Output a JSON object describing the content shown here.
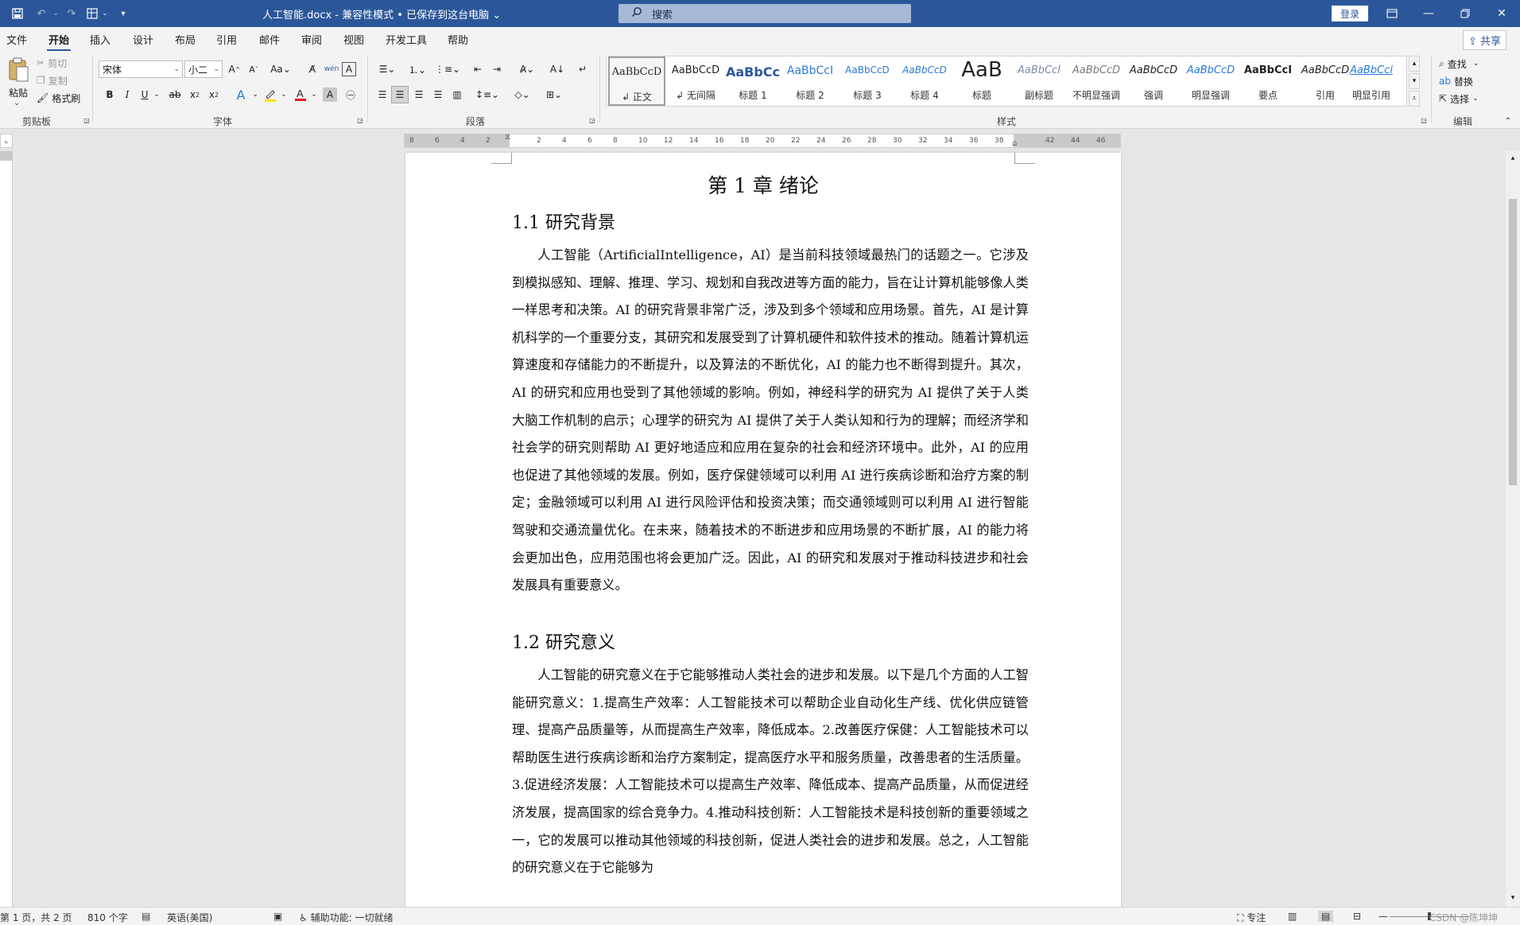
{
  "titlebar": {
    "doc_title": "人工智能.docx  -  兼容性模式 • 已保存到这台电脑 ⌄",
    "search_placeholder": "搜索",
    "login": "登录"
  },
  "tabs": [
    "文件",
    "开始",
    "插入",
    "设计",
    "布局",
    "引用",
    "邮件",
    "审阅",
    "视图",
    "开发工具",
    "帮助"
  ],
  "active_tab": "开始",
  "share": "共享",
  "clipboard": {
    "paste": "粘贴",
    "cut": "剪切",
    "copy": "复制",
    "format_painter": "格式刷",
    "label": "剪贴板"
  },
  "font": {
    "family": "宋体",
    "size": "小二",
    "label": "字体"
  },
  "paragraph": {
    "label": "段落"
  },
  "styles": {
    "label": "样式",
    "items": [
      {
        "sample": "AaBbCcD",
        "name": "↲ 正文"
      },
      {
        "sample": "AaBbCcD",
        "name": "↲ 无间隔"
      },
      {
        "sample": "AaBbCc",
        "name": "标题 1"
      },
      {
        "sample": "AaBbCcI",
        "name": "标题 2"
      },
      {
        "sample": "AaBbCcD",
        "name": "标题 3"
      },
      {
        "sample": "AaBbCcD",
        "name": "标题 4"
      },
      {
        "sample": "AaB",
        "name": "标题"
      },
      {
        "sample": "AaBbCcI",
        "name": "副标题"
      },
      {
        "sample": "AaBbCcD",
        "name": "不明显强调"
      },
      {
        "sample": "AaBbCcD",
        "name": "强调"
      },
      {
        "sample": "AaBbCcD",
        "name": "明显强调"
      },
      {
        "sample": "AaBbCcI",
        "name": "要点"
      },
      {
        "sample": "AaBbCcD",
        "name": "引用"
      },
      {
        "sample": "AaBbCci",
        "name": "明显引用"
      }
    ]
  },
  "editing": {
    "find": "查找",
    "replace": "替换",
    "select": "选择",
    "label": "编辑"
  },
  "ruler_ticks": [
    "8",
    "6",
    "4",
    "2",
    "",
    "2",
    "4",
    "6",
    "8",
    "10",
    "12",
    "14",
    "16",
    "18",
    "20",
    "22",
    "24",
    "26",
    "28",
    "30",
    "32",
    "34",
    "36",
    "38",
    "",
    "42",
    "44",
    "46"
  ],
  "document": {
    "chapter": "第 1 章  绪论",
    "sections": [
      {
        "heading": "1.1  研究背景",
        "body": "人工智能（ArtificialIntelligence，AI）是当前科技领域最热门的话题之一。它涉及到模拟感知、理解、推理、学习、规划和自我改进等方面的能力，旨在让计算机能够像人类一样思考和决策。AI 的研究背景非常广泛，涉及到多个领域和应用场景。首先，AI 是计算机科学的一个重要分支，其研究和发展受到了计算机硬件和软件技术的推动。随着计算机运算速度和存储能力的不断提升，以及算法的不断优化，AI 的能力也不断得到提升。其次，AI 的研究和应用也受到了其他领域的影响。例如，神经科学的研究为 AI 提供了关于人类大脑工作机制的启示；心理学的研究为 AI 提供了关于人类认知和行为的理解；而经济学和社会学的研究则帮助 AI 更好地适应和应用在复杂的社会和经济环境中。此外，AI 的应用也促进了其他领域的发展。例如，医疗保健领域可以利用 AI 进行疾病诊断和治疗方案的制定；金融领域可以利用 AI 进行风险评估和投资决策；而交通领域则可以利用 AI 进行智能驾驶和交通流量优化。在未来，随着技术的不断进步和应用场景的不断扩展，AI 的能力将会更加出色，应用范围也将会更加广泛。因此，AI 的研究和发展对于推动科技进步和社会发展具有重要意义。"
      },
      {
        "heading": "1.2  研究意义",
        "body": "人工智能的研究意义在于它能够推动人类社会的进步和发展。以下是几个方面的人工智能研究意义：1.提高生产效率：人工智能技术可以帮助企业自动化生产线、优化供应链管理、提高产品质量等，从而提高生产效率，降低成本。2.改善医疗保健：人工智能技术可以帮助医生进行疾病诊断和治疗方案制定，提高医疗水平和服务质量，改善患者的生活质量。3.促进经济发展：人工智能技术可以提高生产效率、降低成本、提高产品质量，从而促进经济发展，提高国家的综合竞争力。4.推动科技创新：人工智能技术是科技创新的重要领域之一，它的发展可以推动其他领域的科技创新，促进人类社会的进步和发展。总之，人工智能的研究意义在于它能够为"
      }
    ]
  },
  "status": {
    "page": "第 1 页，共 2 页",
    "words": "810 个字",
    "language": "英语(美国)",
    "accessibility": "辅助功能: 一切就绪",
    "focus": "专注",
    "watermark": "CSDN @陈坤坤"
  }
}
